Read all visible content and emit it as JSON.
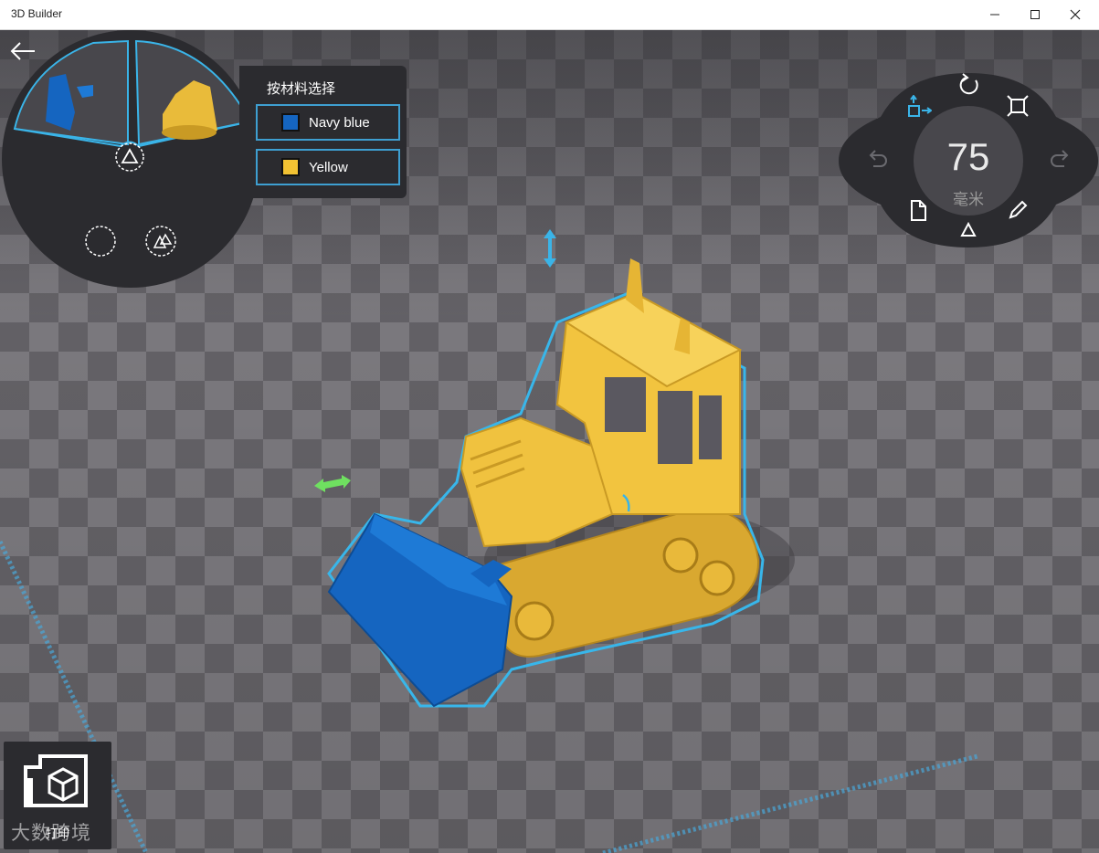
{
  "window": {
    "title": "3D Builder"
  },
  "material_panel": {
    "header": "按材料选择",
    "materials": [
      {
        "label": "Navy blue",
        "color": "#1565c0"
      },
      {
        "label": "Yellow",
        "color": "#f2c233"
      }
    ]
  },
  "dial": {
    "value": "75",
    "unit": "毫米"
  },
  "print_button": {
    "label": "打印"
  },
  "watermark": "大数跨境",
  "colors": {
    "accent": "#3ab4e8",
    "panel": "#2b2b2f",
    "model_yellow": "#f2c233",
    "model_blue": "#1565c0"
  }
}
